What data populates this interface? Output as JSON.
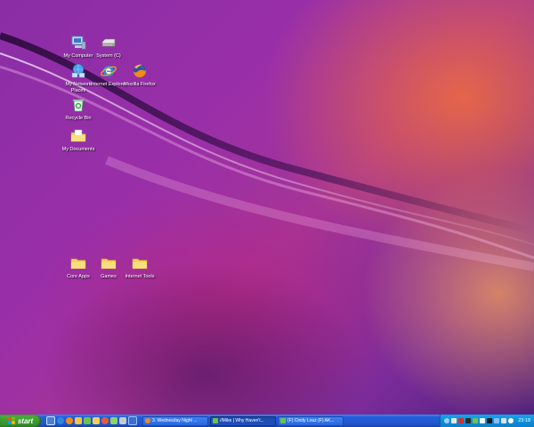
{
  "desktop": {
    "icons": [
      {
        "label": "My Computer",
        "glyph": "my-computer-icon"
      },
      {
        "label": "System (C)",
        "glyph": "drive-icon"
      },
      {
        "label": "My Network Places",
        "glyph": "network-places-icon"
      },
      {
        "label": "Internet Explorer",
        "glyph": "internet-explorer-icon"
      },
      {
        "label": "Mozilla Firefox",
        "glyph": "firefox-icon"
      },
      {
        "label": "Recycle Bin",
        "glyph": "recycle-bin-icon"
      },
      {
        "label": "My Documents",
        "glyph": "my-documents-icon"
      },
      {
        "label": "Core Apps",
        "glyph": "folder-icon"
      },
      {
        "label": "Games",
        "glyph": "folder-icon"
      },
      {
        "label": "Internet Tools",
        "glyph": "folder-icon"
      }
    ]
  },
  "taskbar": {
    "start_label": "start",
    "tasks": [
      {
        "label": "3. Wednesday Night ..."
      },
      {
        "label": "//Mike | Why Haven't..."
      },
      {
        "label": "(F) Cindy Louz (F) AK..."
      }
    ],
    "clock": "23:18"
  },
  "colors": {
    "taskbar_blue": "#245edb",
    "start_green": "#3c9b30",
    "tray_blue": "#0f8fdc"
  }
}
